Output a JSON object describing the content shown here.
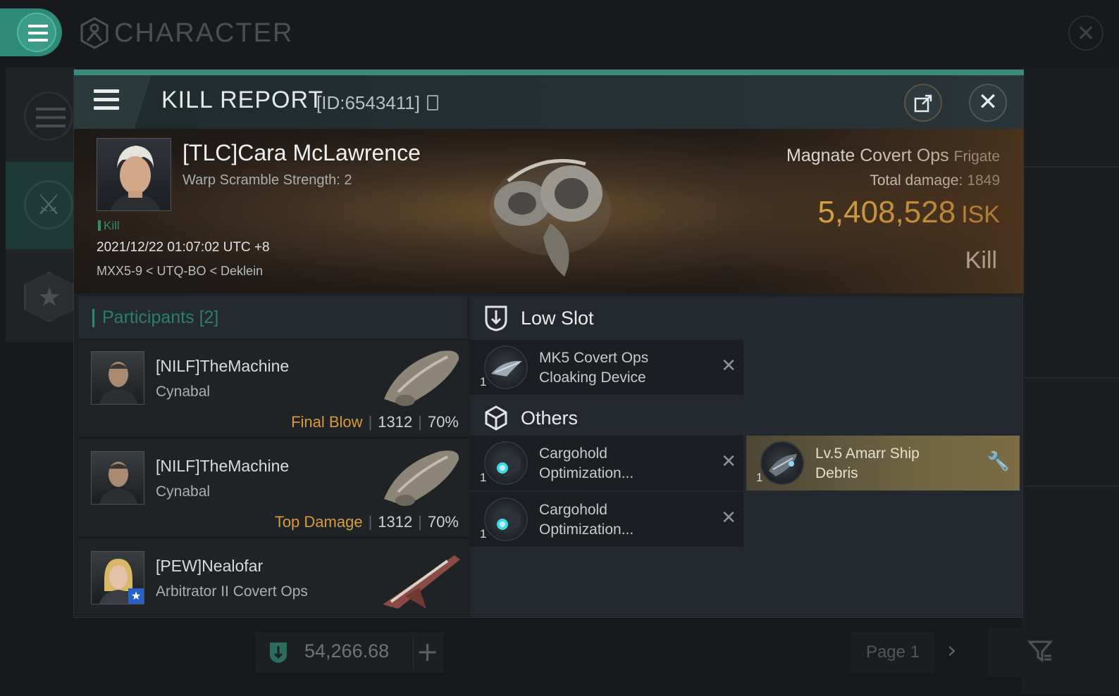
{
  "app": {
    "section_title": "CHARACTER"
  },
  "modal": {
    "title": "KILL REPORT",
    "id_text": "[ID:6543411]"
  },
  "victim": {
    "name": "[TLC]Cara McLawrence",
    "subtitle": "Warp Scramble Strength: 2",
    "tag": "Kill",
    "timestamp": "2021/12/22 01:07:02 UTC +8",
    "location": "MXX5-9 < UTQ-BO < Deklein",
    "ship_name": "Magnate Covert Ops",
    "ship_class": "Frigate",
    "damage_label": "Total damage:",
    "damage_value": "1849",
    "isk_value": "5,408,528",
    "isk_unit": "ISK",
    "result": "Kill"
  },
  "participants": {
    "header_label": "Participants",
    "header_count": "[2]",
    "rows": [
      {
        "name": "[NILF]TheMachine",
        "ship": "Cynabal",
        "role": "Final Blow",
        "damage": "1312",
        "percent": "70%"
      },
      {
        "name": "[NILF]TheMachine",
        "ship": "Cynabal",
        "role": "Top Damage",
        "damage": "1312",
        "percent": "70%"
      },
      {
        "name": "[PEW]Nealofar",
        "ship": "Arbitrator II Covert Ops"
      }
    ]
  },
  "slots": {
    "low_slot": {
      "label": "Low Slot",
      "items": [
        {
          "qty": "1",
          "name": "MK5 Covert Ops\nCloaking Device"
        }
      ]
    },
    "others": {
      "label": "Others",
      "items": [
        {
          "qty": "1",
          "name": "Cargohold\nOptimization..."
        },
        {
          "qty": "1",
          "name": "Lv.5 Amarr Ship\nDebris"
        },
        {
          "qty": "1",
          "name": "Cargohold\nOptimization..."
        }
      ]
    }
  },
  "footer": {
    "currency_value": "54,266.68",
    "page_label": "Page 1"
  },
  "colors": {
    "accent": "#2f8a78",
    "isk_gold": "#e8b14a",
    "role_orange": "#d89a3a",
    "debris_gold": "#7c6c45"
  }
}
